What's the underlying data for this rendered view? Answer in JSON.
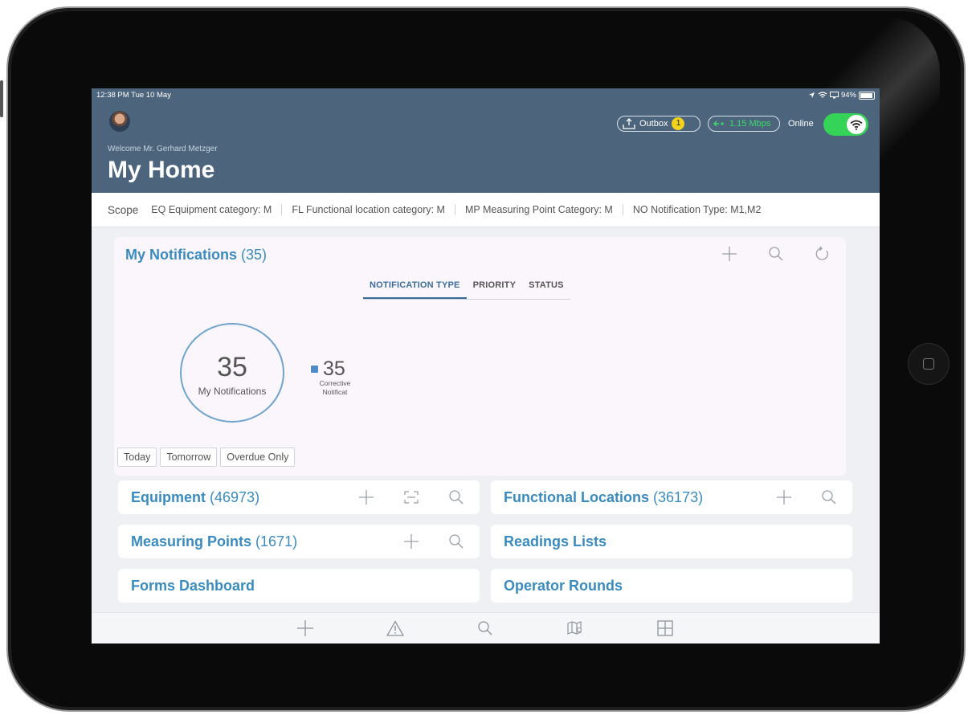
{
  "status_bar": {
    "time": "12:38 PM  Tue 10 May",
    "battery": "94%"
  },
  "header": {
    "welcome": "Welcome Mr. Gerhard Metzger",
    "title": "My Home",
    "outbox_label": "Outbox",
    "outbox_count": "1",
    "speed": "1.15 Mbps",
    "online_label": "Online",
    "online": true
  },
  "scope": {
    "label": "Scope",
    "items": [
      "EQ Equipment category: M",
      "FL Functional location category: M",
      "MP Measuring Point Category: M",
      "NO Notification Type: M1,M2"
    ]
  },
  "notifications": {
    "title": "My Notifications",
    "count": "(35)",
    "tabs": [
      "NOTIFICATION TYPE",
      "PRIORITY",
      "STATUS"
    ],
    "active_tab": "NOTIFICATION TYPE",
    "total": "35",
    "total_label": "My Notifications",
    "legend": [
      {
        "value": "35",
        "label": "Corrective Notificat",
        "color": "#4e8cc9"
      }
    ],
    "filters": [
      "Today",
      "Tomorrow",
      "Overdue Only"
    ]
  },
  "tiles": {
    "equipment": {
      "title": "Equipment",
      "count": "(46973)"
    },
    "functional_locations": {
      "title": "Functional Locations",
      "count": "(36173)"
    },
    "measuring_points": {
      "title": "Measuring Points",
      "count": "(1671)"
    },
    "readings_lists": {
      "title": "Readings Lists"
    },
    "forms_dashboard": {
      "title": "Forms Dashboard"
    },
    "operator_rounds": {
      "title": "Operator Rounds"
    }
  },
  "colors": {
    "header": "#4d657c",
    "accent": "#3a8bbf",
    "online_toggle": "#35d357",
    "badge": "#f5d31c"
  },
  "tabbar_icons": [
    "plus-icon",
    "warning-icon",
    "search-icon",
    "map-icon",
    "grid-icon"
  ]
}
